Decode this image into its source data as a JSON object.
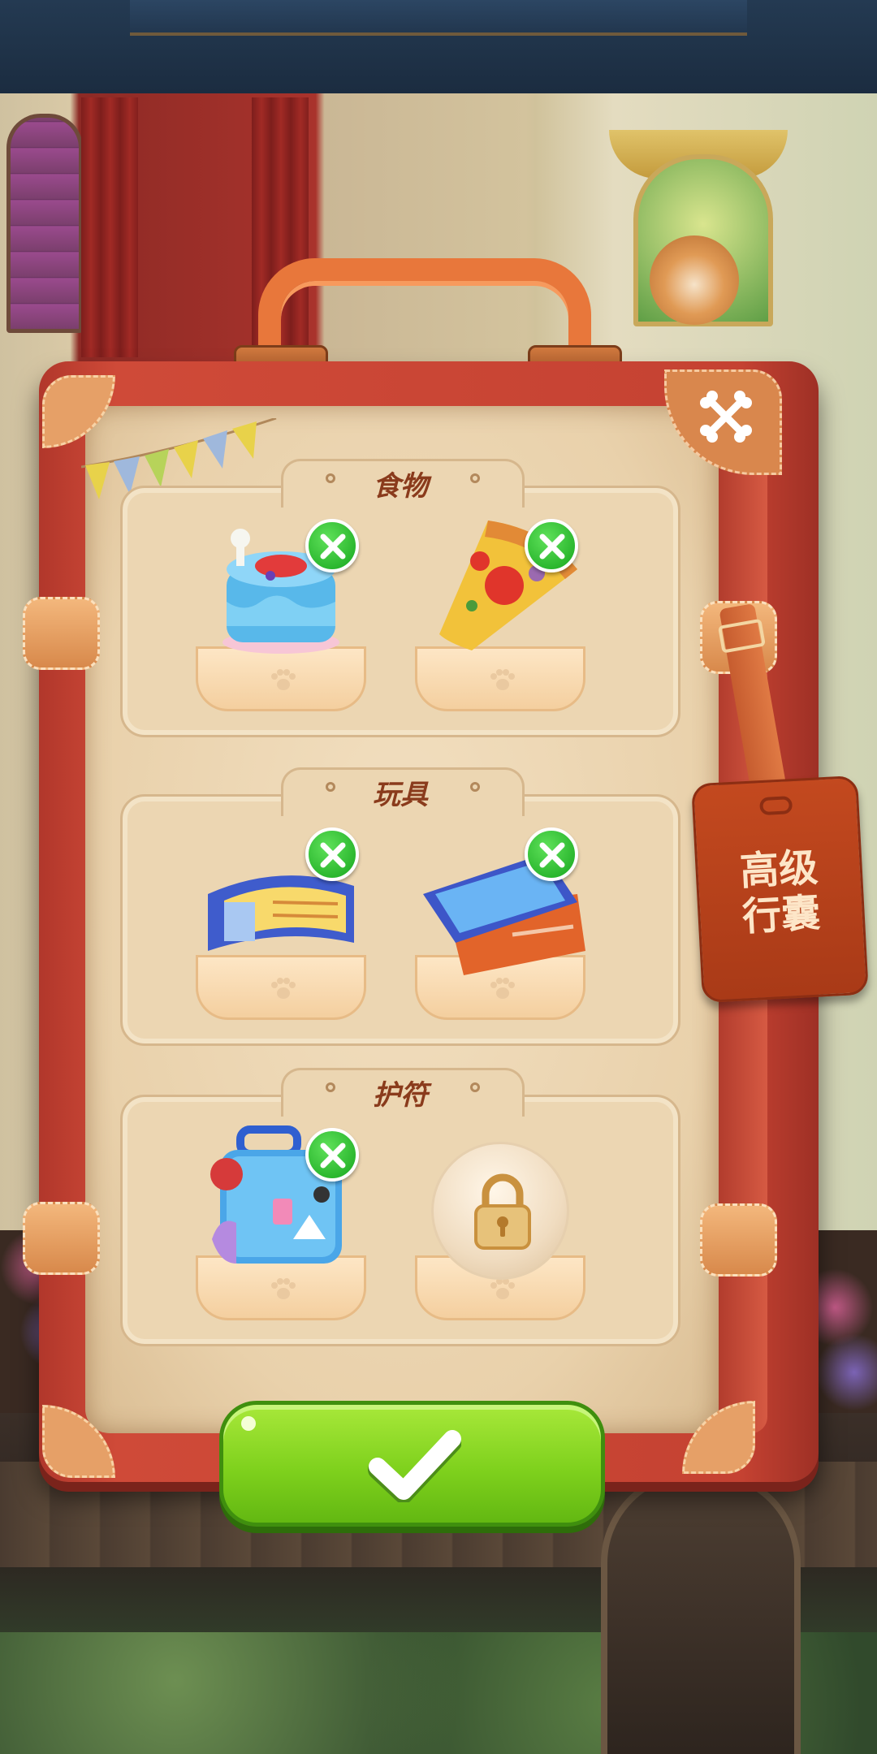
{
  "colors": {
    "case_red": "#c54232",
    "panel_cream": "#ecd6b2",
    "title_brown": "#8a3b1c",
    "remove_green": "#16a61d",
    "confirm_green": "#7fd11d",
    "tag_orange": "#b8431c"
  },
  "header": {
    "close_icon": "crossed-bones-icon"
  },
  "tag": {
    "line1": "高级",
    "line2": "行囊"
  },
  "sections": [
    {
      "title": "食物",
      "slots": [
        {
          "item": "cake-icon",
          "removable": true
        },
        {
          "item": "pizza-slice-icon",
          "removable": true
        }
      ]
    },
    {
      "title": "玩具",
      "slots": [
        {
          "item": "ticket-icon",
          "removable": true
        },
        {
          "item": "cards-icon",
          "removable": true
        }
      ]
    },
    {
      "title": "护符",
      "slots": [
        {
          "item": "travel-suitcase-icon",
          "removable": true
        },
        {
          "item": "padlock-icon",
          "locked": true
        }
      ]
    }
  ],
  "confirm": {
    "icon": "checkmark-icon"
  }
}
